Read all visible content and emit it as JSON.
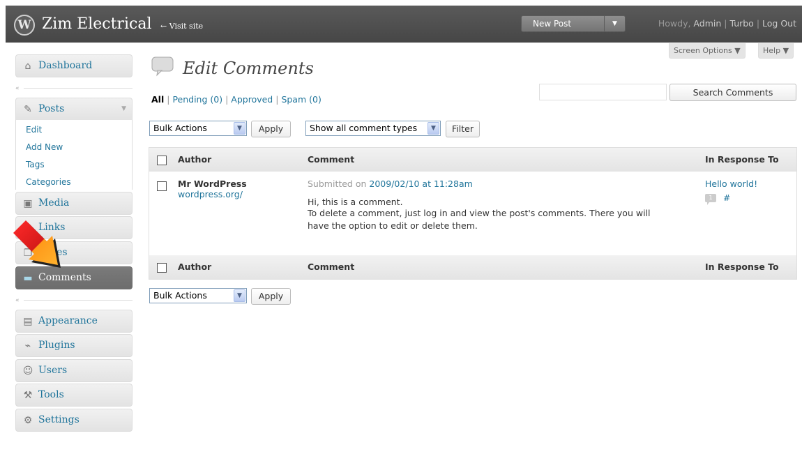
{
  "header": {
    "logo_text": "W",
    "site_title": "Zim Electrical",
    "visit_site": "← Visit site",
    "new_post": "New Post",
    "howdy": "Howdy,",
    "user": "Admin",
    "turbo": "Turbo",
    "logout": "Log Out",
    "sep": "|"
  },
  "screen_options": "Screen Options ▼",
  "help": "Help ▼",
  "sidebar": {
    "dashboard": "Dashboard",
    "posts": "Posts",
    "posts_sub": [
      "Edit",
      "Add New",
      "Tags",
      "Categories"
    ],
    "media": "Media",
    "links": "Links",
    "pages": "Pages",
    "comments": "Comments",
    "appearance": "Appearance",
    "plugins": "Plugins",
    "users": "Users",
    "tools": "Tools",
    "settings": "Settings",
    "separator": "«"
  },
  "page": {
    "title": "Edit Comments",
    "filters": {
      "all": "All",
      "pending": "Pending (0)",
      "approved": "Approved",
      "spam": "Spam (0)",
      "sep": "|"
    },
    "search_button": "Search Comments",
    "bulk_actions": "Bulk Actions",
    "apply": "Apply",
    "comment_types": "Show all comment types",
    "filter": "Filter"
  },
  "table": {
    "columns": [
      "Author",
      "Comment",
      "In Response To"
    ],
    "rows": [
      {
        "author": "Mr WordPress",
        "author_url": "wordpress.org/",
        "submitted_prefix": "Submitted on ",
        "submitted_date": "2009/02/10 at 11:28am",
        "lines": [
          "Hi, this is a comment.",
          "To delete a comment, just log in and view the post's comments. There you will",
          "have the option to edit or delete them."
        ],
        "response": "Hello world!",
        "comment_count": "1",
        "hash": "#"
      }
    ]
  }
}
